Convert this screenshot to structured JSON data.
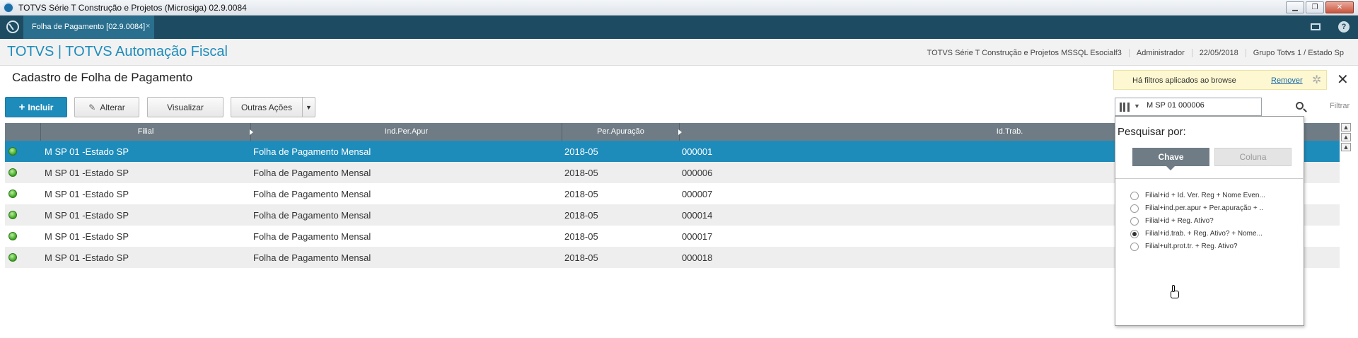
{
  "window": {
    "title": "TOTVS Série T Construção e Projetos (Microsiga) 02.9.0084",
    "minimize": "▁",
    "maximize": "❐",
    "close": "✕"
  },
  "tabbar": {
    "active_tab": "Folha de Pagamento [02.9.0084]",
    "tab_close": "×",
    "help": "?"
  },
  "header": {
    "brand": "TOTVS | TOTVS Automação Fiscal",
    "environment": "TOTVS Série T Construção e Projetos MSSQL Esocialf3",
    "user": "Administrador",
    "date": "22/05/2018",
    "company": "Grupo Totvs 1 / Estado Sp"
  },
  "page": {
    "title": "Cadastro de Folha de Pagamento"
  },
  "filter_banner": {
    "text": "Há filtros aplicados ao browse",
    "remove": "Remover"
  },
  "toolbar": {
    "plus": "+",
    "incluir": "Incluir",
    "pencil": "✎",
    "alterar": "Alterar",
    "visualizar": "Visualizar",
    "outras_acoes": "Outras Ações",
    "dropdown": "▼"
  },
  "search": {
    "value": "M SP 01 000006",
    "filtrar": "Filtrar",
    "caret": "▼"
  },
  "grid": {
    "columns": [
      "Filial",
      "Ind.Per.Apur",
      "Per.Apuração",
      "Id.Trab."
    ],
    "rows": [
      {
        "filial": "M SP 01 -Estado SP",
        "ind": "Folha de Pagamento Mensal",
        "per": "2018-05",
        "id": "000001",
        "status": "green",
        "selected": true
      },
      {
        "filial": "M SP 01 -Estado SP",
        "ind": "Folha de Pagamento Mensal",
        "per": "2018-05",
        "id": "000006",
        "status": "green",
        "selected": false
      },
      {
        "filial": "M SP 01 -Estado SP",
        "ind": "Folha de Pagamento Mensal",
        "per": "2018-05",
        "id": "000007",
        "status": "green",
        "selected": false
      },
      {
        "filial": "M SP 01 -Estado SP",
        "ind": "Folha de Pagamento Mensal",
        "per": "2018-05",
        "id": "000014",
        "status": "green",
        "selected": false
      },
      {
        "filial": "M SP 01 -Estado SP",
        "ind": "Folha de Pagamento Mensal",
        "per": "2018-05",
        "id": "000017",
        "status": "green",
        "selected": false
      },
      {
        "filial": "M SP 01 -Estado SP",
        "ind": "Folha de Pagamento Mensal",
        "per": "2018-05",
        "id": "000018",
        "status": "green",
        "selected": false
      }
    ]
  },
  "scrollbar": {
    "top": "▲",
    "up": "▲",
    "down": "▲"
  },
  "popup": {
    "title": "Pesquisar por:",
    "segments": [
      "Chave",
      "Coluna"
    ],
    "options": [
      {
        "label": "Filial+id + Id. Ver. Reg + Nome Even...",
        "checked": false
      },
      {
        "label": "Filial+ind.per.apur + Per.apuração + ..",
        "checked": false
      },
      {
        "label": "Filial+id + Reg. Ativo?",
        "checked": false
      },
      {
        "label": "Filial+id.trab. + Reg. Ativo? + Nome...",
        "checked": true
      },
      {
        "label": "Filial+ult.prot.tr. + Reg. Ativo?",
        "checked": false
      }
    ]
  },
  "colors": {
    "accent": "#1e8cbb",
    "tabbar": "#1d4c62",
    "grid_header": "#6f7c85",
    "status_green": "#3aa320"
  },
  "icons": [
    "app-icon",
    "home-icon",
    "mail-icon",
    "help-icon",
    "gear-icon",
    "close-icon",
    "columns-icon",
    "search-icon",
    "pointer-hand-icon"
  ]
}
